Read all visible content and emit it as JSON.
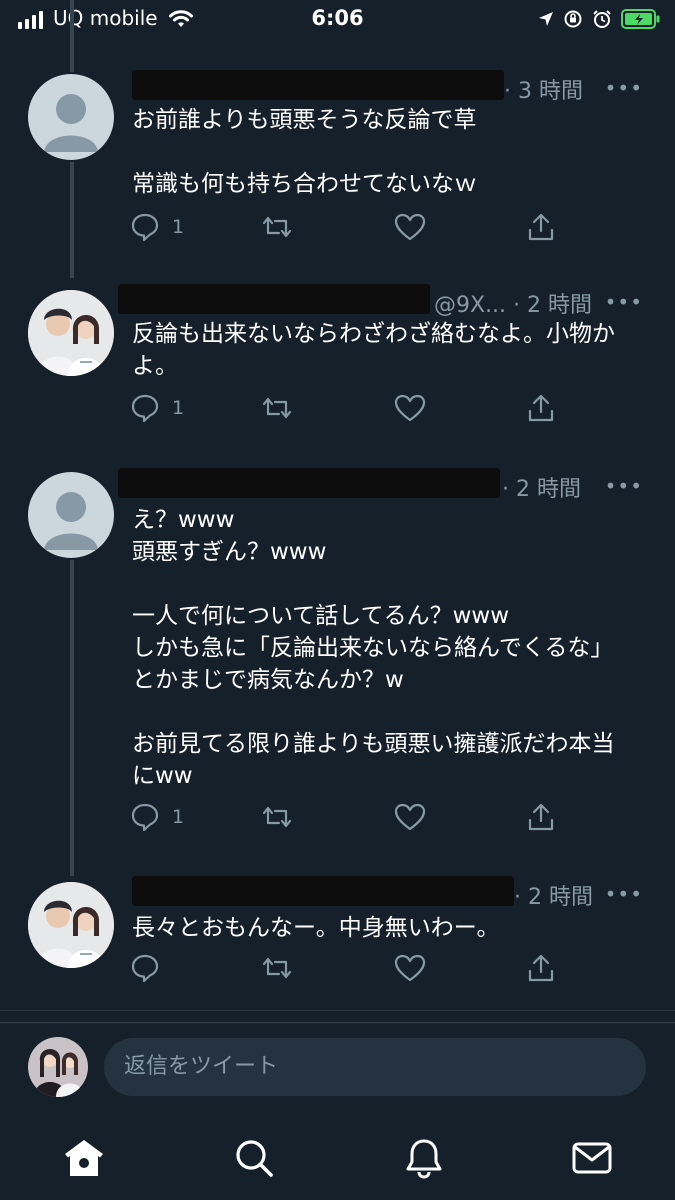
{
  "status_bar": {
    "carrier": "UQ mobile",
    "time": "6:06"
  },
  "tweets": [
    {
      "avatar": "default-profile",
      "handle": "",
      "time": "· 3 時間",
      "text": "お前誰よりも頭悪そうな反論で草\n\n常識も何も持ち合わせてないなｗ",
      "reply_count": "1"
    },
    {
      "avatar": "photo-profile",
      "handle": "@9X...",
      "time": "· 2 時間",
      "text": "反論も出来ないならわざわざ絡むなよ。小物か\nよ。",
      "reply_count": "1"
    },
    {
      "avatar": "default-profile",
      "handle": "",
      "time": "· 2 時間",
      "text": "え？www\n頭悪すぎん？www\n\n一人で何について話してるん？www\nしかも急に「反論出来ないなら絡んでくるな」\nとかまじで病気なんか？w\n\nお前見てる限り誰よりも頭悪い擁護派だわ本当\nにww",
      "reply_count": "1"
    },
    {
      "avatar": "photo-profile",
      "handle": "",
      "time": "· 2 時間",
      "text": "長々とおもんなー。中身無いわー。",
      "reply_count": ""
    }
  ],
  "more_label": "•••",
  "reply_bar": {
    "placeholder": "返信をツイート"
  },
  "tab_bar": [
    "home-icon",
    "search-icon",
    "notifications-icon",
    "messages-icon"
  ],
  "colors": {
    "background": "#15202b",
    "secondary_text": "#8899a6",
    "thread_line": "#38444d",
    "battery": "#4cd964"
  }
}
